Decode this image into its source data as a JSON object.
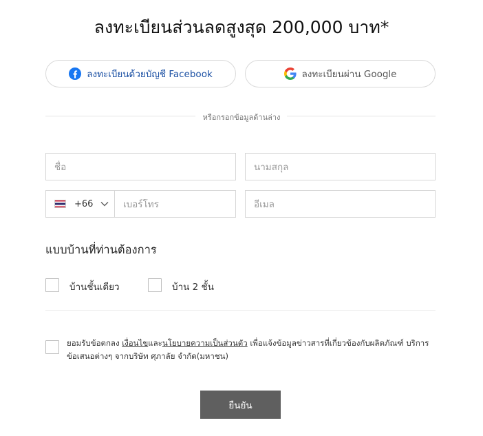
{
  "title": "ลงทะเบียนส่วนลดสูงสุด 200,000 บาท*",
  "social": {
    "facebook_label": "ลงทะเบียนด้วยบัญชี Facebook",
    "google_label": "ลงทะเบียนผ่าน Google"
  },
  "divider_text": "หรือกรอกข้อมูลด้านล่าง",
  "form": {
    "first_name_placeholder": "ชื่อ",
    "last_name_placeholder": "นามสกุล",
    "country_code": "+66",
    "phone_placeholder": "เบอร์โทร",
    "email_placeholder": "อีเมล"
  },
  "house_type": {
    "title": "แบบบ้านที่ท่านต้องการ",
    "options": [
      "บ้านชั้นเดียว",
      "บ้าน 2 ชั้น"
    ]
  },
  "consent": {
    "prefix": "ยอมรับข้อตกลง ",
    "terms_link": "เงื่อนไข",
    "and": "และ",
    "privacy_link": "นโยบายความเป็นส่วนตัว",
    "suffix": " เพื่อแจ้งข้อมูลข่าวสารที่เกี่ยวข้องกับผลิตภัณฑ์ บริการ ข้อเสนอต่างๆ จากบริษัท ศุภาลัย จำกัด(มหาชน)"
  },
  "submit_label": "ยืนยัน",
  "colors": {
    "facebook_blue": "#1877f2",
    "submit_bg": "#5f5f5f",
    "border": "#d6d6d6"
  }
}
